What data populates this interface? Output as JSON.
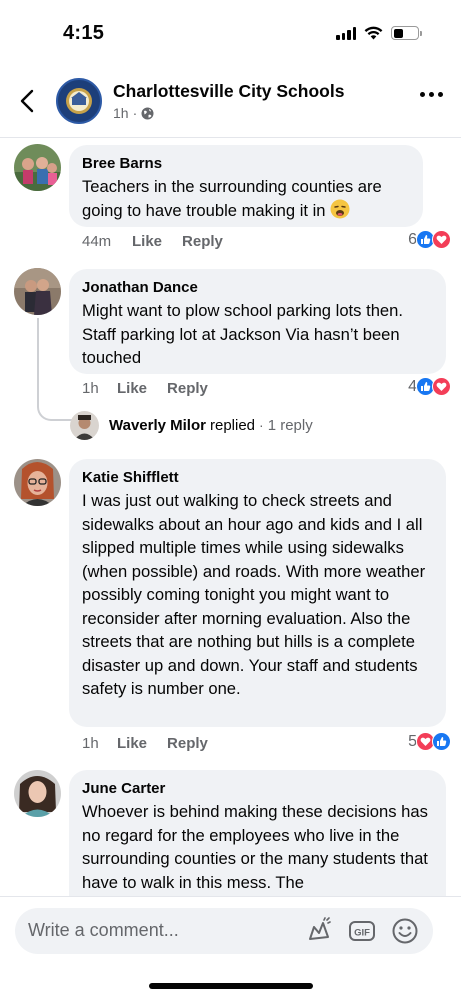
{
  "status_bar": {
    "time": "4:15"
  },
  "header": {
    "page_name": "Charlottesville City Schools",
    "time_ago": "1h",
    "separator": "·"
  },
  "comments": [
    {
      "author": "Bree Barns",
      "text": "Teachers in the surrounding counties are going to have trouble making it in",
      "emoji": "weary-face",
      "time": "44m",
      "like_label": "Like",
      "reply_label": "Reply",
      "reaction_count": "6",
      "reactions": [
        "like",
        "love"
      ]
    },
    {
      "author": "Jonathan Dance",
      "text": "Might want to plow school parking lots then. Staff parking lot at Jackson Via hasn’t been touched",
      "time": "1h",
      "like_label": "Like",
      "reply_label": "Reply",
      "reaction_count": "4",
      "reactions": [
        "like",
        "love"
      ]
    },
    {
      "author": "Katie Shifflett",
      "text": "I was just out walking to check streets and sidewalks about an hour ago and kids and I all slipped multiple times while using sidewalks (when possible) and roads. With more weather possibly coming tonight you might want to reconsider after morning evaluation. Also the streets that are nothing but hills is a complete disaster up and down. Your staff and students safety is number one.",
      "time": "1h",
      "like_label": "Like",
      "reply_label": "Reply",
      "reaction_count": "5",
      "reactions": [
        "love",
        "like"
      ]
    },
    {
      "author": "June Carter",
      "text": "Whoever is behind making these decisions has no regard for the employees who live in the surrounding counties or the many students that have to walk in this mess. The"
    }
  ],
  "reply_summary": {
    "name": "Waverly Milor",
    "verb": "replied",
    "separator": "·",
    "count": "1 reply"
  },
  "composer": {
    "placeholder": "Write a comment...",
    "icons": [
      "sticker-icon",
      "gif-icon",
      "emoji-icon"
    ]
  },
  "colors": {
    "bubble": "#f0f2f5",
    "like_blue": "#1877f2",
    "love_red": "#f33e58",
    "meta_gray": "#65676b"
  }
}
